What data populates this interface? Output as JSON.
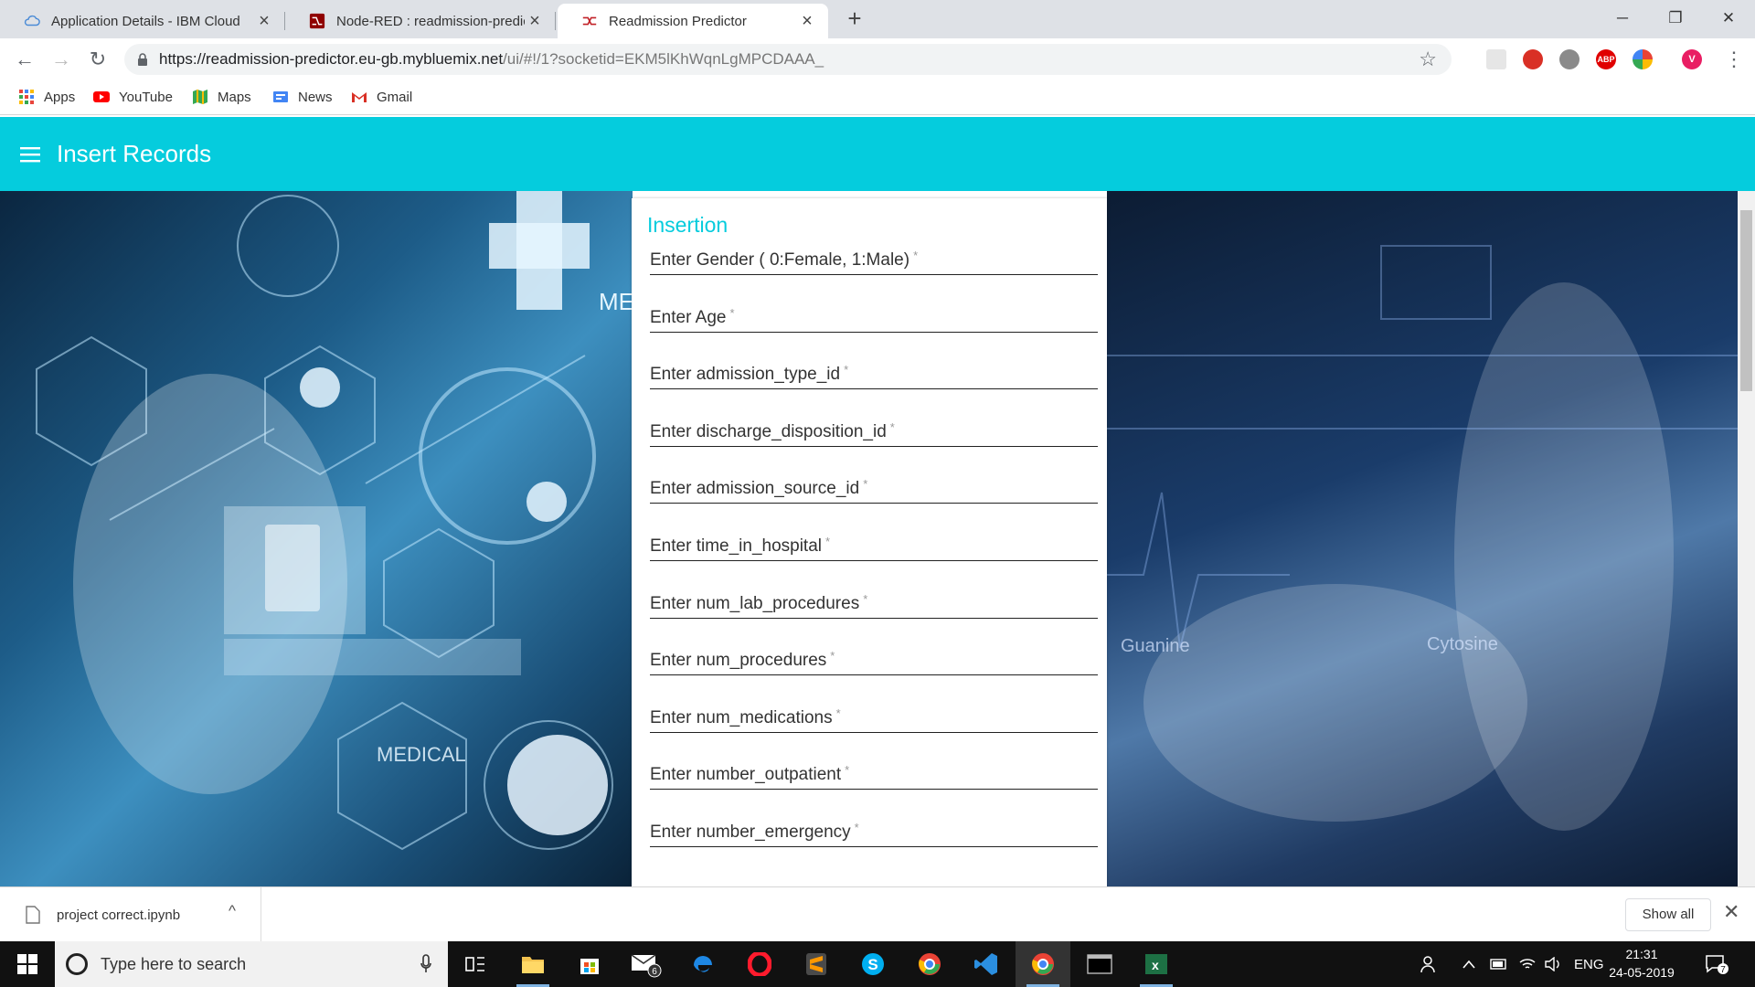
{
  "browser": {
    "tabs": [
      {
        "title": "Application Details - IBM Cloud",
        "icon": "cloud-icon",
        "active": false
      },
      {
        "title": "Node-RED : readmission-predictor",
        "icon": "node-red-icon",
        "active": false
      },
      {
        "title": "Readmission Predictor",
        "icon": "node-red-dashboard-icon",
        "active": true
      }
    ],
    "new_tab": "+",
    "window_controls": {
      "minimize": "─",
      "restore": "❐",
      "close": "✕"
    },
    "nav": {
      "back": "←",
      "forward": "→",
      "reload": "↻"
    },
    "url": {
      "host": "https://readmission-predictor.eu-gb.mybluemix.net",
      "path": "/ui/#!/1?socketid=EKM5lKhWqnLgMPCDAAA_"
    },
    "star": "☆",
    "extensions": [
      {
        "name": "pocket-icon",
        "label": "",
        "color": "#d0d0d0"
      },
      {
        "name": "cast-icon",
        "label": "",
        "color": "#d93025"
      },
      {
        "name": "cloud-extension-icon",
        "label": "",
        "color": "#9e9e9e"
      },
      {
        "name": "adblock-icon",
        "label": "ABP",
        "color": "#e00000"
      },
      {
        "name": "google-extension-icon",
        "label": "",
        "color": "#34a853"
      },
      {
        "name": "profile-avatar",
        "label": "V",
        "color": "#e91e63"
      }
    ],
    "more": "⋮",
    "bookmarks": [
      {
        "label": "Apps",
        "icon": "apps-grid-icon"
      },
      {
        "label": "YouTube",
        "icon": "youtube-icon"
      },
      {
        "label": "Maps",
        "icon": "maps-icon"
      },
      {
        "label": "News",
        "icon": "news-icon"
      },
      {
        "label": "Gmail",
        "icon": "gmail-icon"
      }
    ]
  },
  "page": {
    "title": "Insert Records",
    "card_title": "Insertion",
    "required_mark": "*",
    "fields": [
      "Enter Gender ( 0:Female, 1:Male)",
      "Enter Age",
      "Enter admission_type_id",
      "Enter discharge_disposition_id",
      "Enter admission_source_id",
      "Enter time_in_hospital",
      "Enter num_lab_procedures",
      "Enter num_procedures",
      "Enter num_medications",
      "Enter number_outpatient",
      "Enter number_emergency"
    ],
    "bg_left_labels": {
      "me": "ME",
      "medical": "MEDICAL"
    },
    "bg_right_labels": {
      "guanine": "Guanine",
      "cytosine": "Cytosine"
    },
    "accent_color": "#05ccdd"
  },
  "downloads": {
    "file_name": "project correct.ipynb",
    "chevron": "^",
    "show_all": "Show all",
    "close": "✕"
  },
  "taskbar": {
    "search_placeholder": "Type here to search",
    "apps": [
      {
        "name": "task-view-icon"
      },
      {
        "name": "file-explorer-icon"
      },
      {
        "name": "store-icon"
      },
      {
        "name": "mail-icon",
        "badge": "6"
      },
      {
        "name": "edge-icon"
      },
      {
        "name": "opera-icon"
      },
      {
        "name": "sublime-text-icon"
      },
      {
        "name": "skype-icon"
      },
      {
        "name": "chrome-icon"
      },
      {
        "name": "vscode-icon"
      },
      {
        "name": "chrome-active-icon"
      },
      {
        "name": "terminal-icon"
      },
      {
        "name": "excel-icon"
      }
    ],
    "tray": {
      "language": "ENG",
      "time": "21:31",
      "date": "24-05-2019",
      "notifications": "7"
    }
  }
}
